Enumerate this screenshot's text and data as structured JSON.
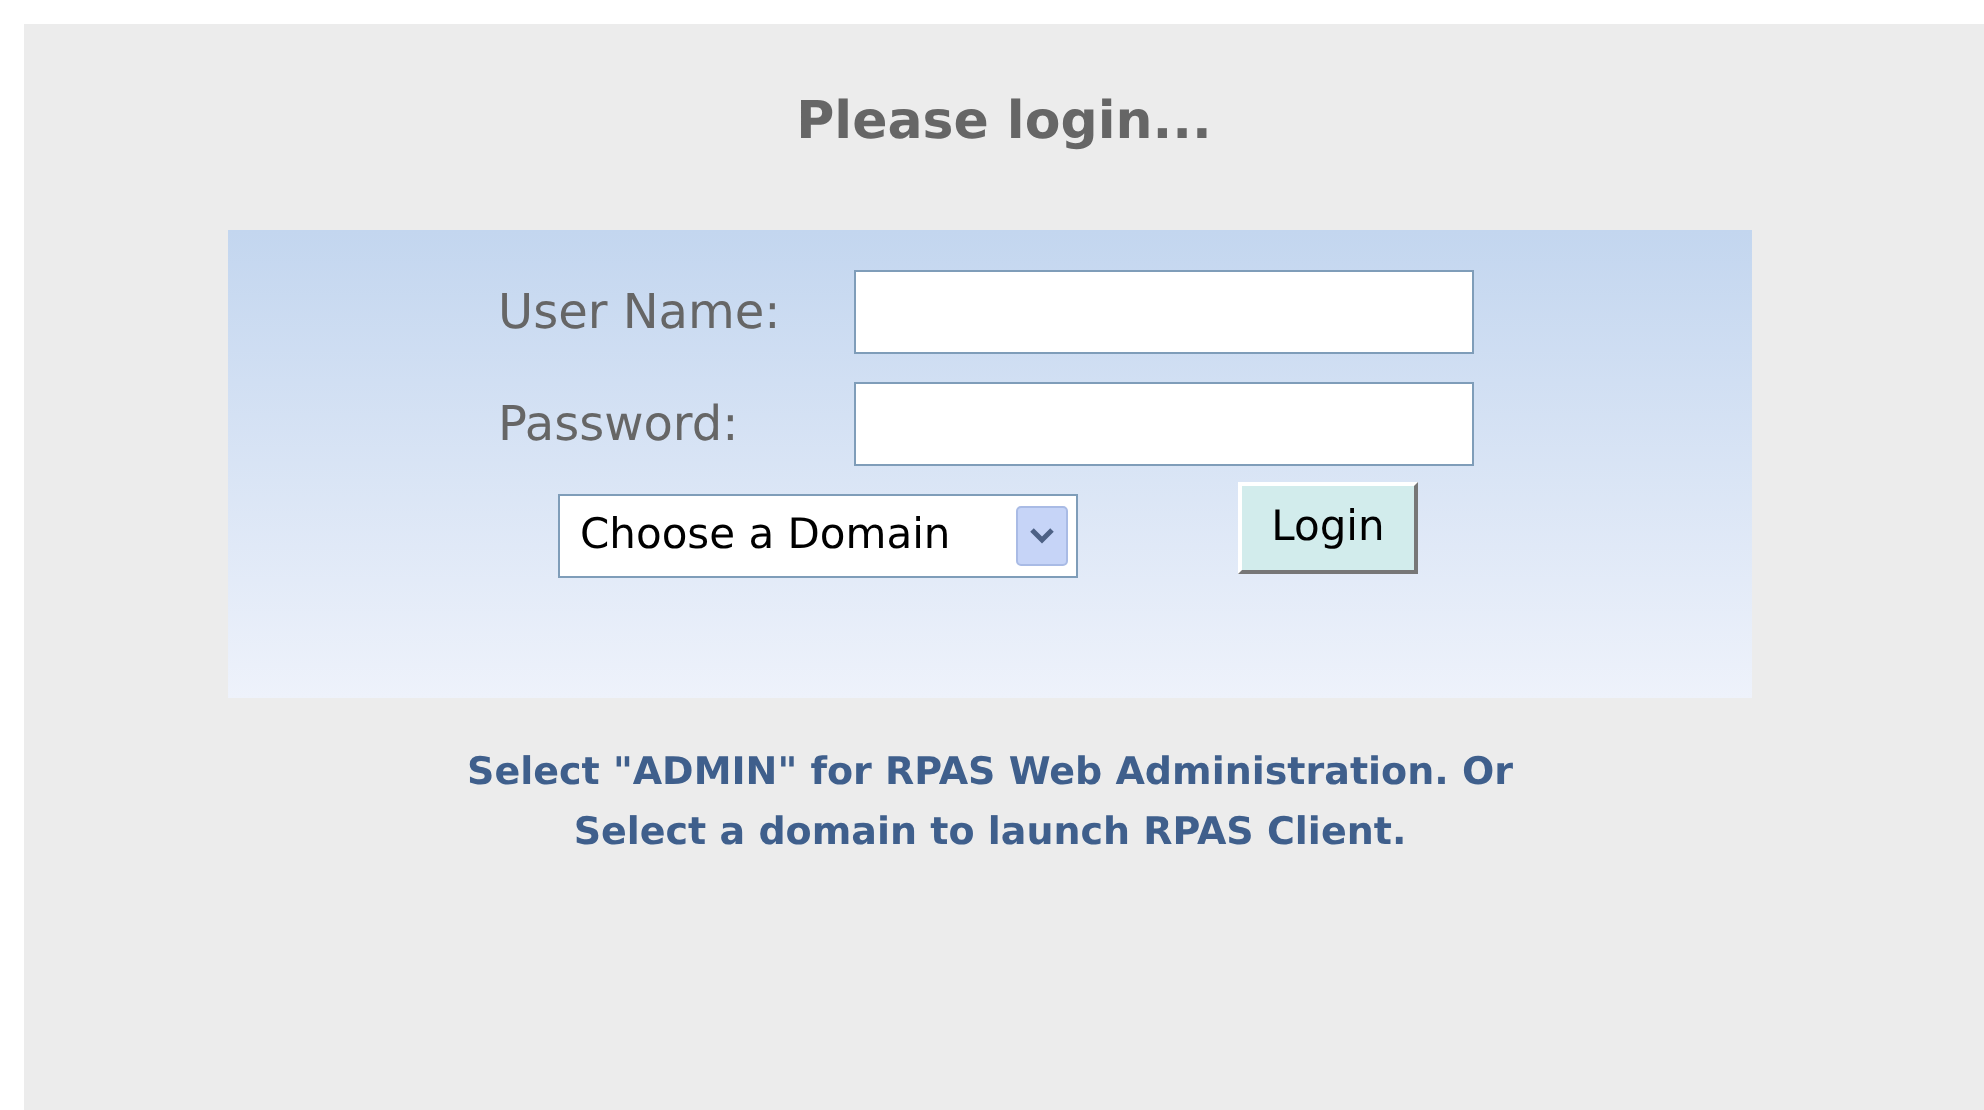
{
  "title": "Please login...",
  "username_field": {
    "label": "User Name:"
  },
  "password_field": {
    "label": "Password:"
  },
  "domain_select": {
    "value": "Choose a Domain"
  },
  "login_button": "Login",
  "hint": [
    "Select \"ADMIN\" for RPAS Web Administration. Or",
    "Select a domain to launch RPAS Client."
  ]
}
